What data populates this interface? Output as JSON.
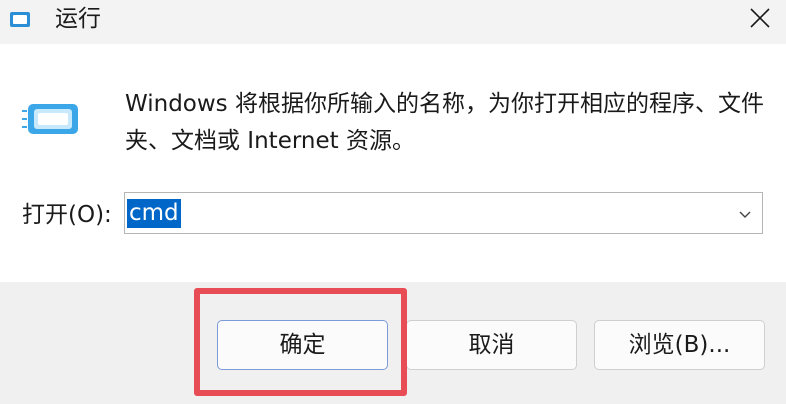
{
  "window": {
    "title": "运行",
    "icon": "run-app-icon",
    "close_icon": "close-icon"
  },
  "dialog": {
    "description": "Windows 将根据你所输入的名称，为你打开相应的程序、文件夹、文档或 Internet 资源。",
    "open_label": "打开(O):",
    "open_value": "cmd",
    "dropdown_icon": "chevron-down-icon"
  },
  "buttons": {
    "ok": "确定",
    "cancel": "取消",
    "browse": "浏览(B)..."
  },
  "colors": {
    "selection": "#0066c7",
    "highlight_border": "#e84c55",
    "footer_bg": "#f0f0f0",
    "titlebar_bg": "#f3f3f3"
  }
}
